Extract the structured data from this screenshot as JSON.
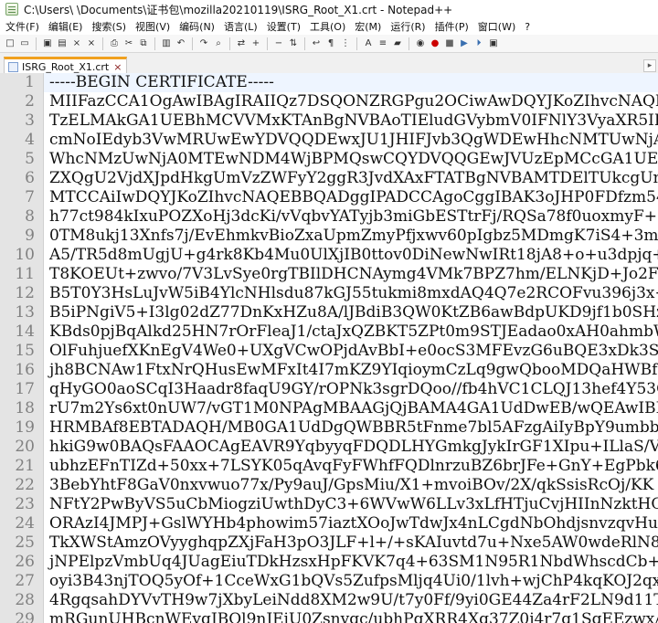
{
  "window": {
    "title": "C:\\Users\\          \\Documents\\证书包\\mozilla20210119\\ISRG_Root_X1.crt - Notepad++"
  },
  "menu": {
    "items": [
      "文件(F)",
      "编辑(E)",
      "搜索(S)",
      "视图(V)",
      "编码(N)",
      "语言(L)",
      "设置(T)",
      "工具(O)",
      "宏(M)",
      "运行(R)",
      "插件(P)",
      "窗口(W)",
      "?"
    ]
  },
  "toolbar": {
    "icons": [
      "new-file-icon",
      "open-file-icon",
      "save-icon",
      "save-all-icon",
      "close-icon",
      "close-all-icon",
      "print-icon",
      "cut-icon",
      "copy-icon",
      "paste-icon",
      "undo-icon",
      "redo-icon",
      "find-icon",
      "replace-icon",
      "zoom-in-icon",
      "zoom-out-icon",
      "sync-scroll-icon",
      "word-wrap-icon",
      "show-all-characters-icon",
      "indent-guide-icon",
      "language-icon",
      "function-list-icon",
      "folder-as-workspace-icon",
      "monitoring-icon",
      "record-macro-icon",
      "stop-recording-icon",
      "playback-macro-icon",
      "run-macro-icon",
      "save-macro-icon"
    ]
  },
  "tabs": [
    {
      "label": "ISRG_Root_X1.crt",
      "close_symbol": "×"
    }
  ],
  "editor": {
    "lines": [
      "-----BEGIN CERTIFICATE-----",
      "MIIFazCCA1OgAwIBAgIRAIIQz7DSQONZRGPgu2OCiwAwDQYJKoZIhvcNAQELBQAw",
      "TzELMAkGA1UEBhMCVVMxKTAnBgNVBAoTIEludGVybmV0IFNlY3VyaXR5IFJlc2Vh",
      "cmNoIEdyb3VwMRUwEwYDVQQDEwxJU1JHIFJvb3QgWDEwHhcNMTUwNjA0MTEwNDM4",
      "WhcNMzUwNjA0MTEwNDM4WjBPMQswCQYDVQQGEwJVUzEpMCcGA1UEChMgSW50ZXJu",
      "ZXQgU2VjdXJpdHkgUmVzZWFyY2ggR3JvdXAxFTATBgNVBAMTDElTUkcgUm9vdCBY",
      "MTCCAiIwDQYJKoZIhvcNAQEBBQADggIPADCCAgoCggIBAK3oJHP0FDfzm54rVygc",
      "h77ct984kIxuPOZXoHj3dcKi/vVqbvYATyjb3miGbESTtrFj/RQSa78f0uoxmyF+",
      "0TM8ukj13Xnfs7j/EvEhmkvBioZxaUpmZmyPfjxwv60pIgbz5MDmgK7iS4+3mX6U",
      "A5/TR5d8mUgjU+g4rk8Kb4Mu0UlXjIB0ttov0DiNewNwIRt18jA8+o+u3dpjq+sW",
      "T8KOEUt+zwvo/7V3LvSye0rgTBIlDHCNAymg4VMk7BPZ7hm/ELNKjD+Jo2FR3qyH",
      "B5T0Y3HsLuJvW5iB4YlcNHlsdu87kGJ55tukmi8mxdAQ4Q7e2RCOFvu396j3x+UC",
      "B5iPNgiV5+I3lg02dZ77DnKxHZu8A/lJBdiB3QW0KtZB6awBdpUKD9jf1b0SHzUv",
      "KBds0pjBqAlkd25HN7rOrFleaJ1/ctaJxQZBKT5ZPt0m9STJEadao0xAH0ahmbWn",
      "OlFuhjuefXKnEgV4We0+UXgVCwOPjdAvBbI+e0ocS3MFEvzG6uBQE3xDk3SzynTn",
      "jh8BCNAw1FtxNrQHusEwMFxIt4I7mKZ9YIqioymCzLq9gwQbooMDQaHWBfEbwrbw",
      "qHyGO0aoSCqI3Haadr8faqU9GY/rOPNk3sgrDQoo//fb4hVC1CLQJ13hef4Y53CI",
      "rU7m2Ys6xt0nUW7/vGT1M0NPAgMBAAGjQjBAMA4GA1UdDwEB/wQEAwIBBjAPBgNV",
      "HRMBAf8EBTADAQH/MB0GA1UdDgQWBBR5tFnme7bl5AFzgAiIyBpY9umbbjANBgkq",
      "hkiG9w0BAQsFAAOCAgEAVR9YqbyyqFDQDLHYGmkgJykIrGF1XIpu+ILlaS/V9lZL",
      "ubhzEFnTIZd+50xx+7LSYK05qAvqFyFWhfFQDlnrzuBZ6brJFe+GnY+EgPbk6ZGQ",
      "3BebYhtF8GaV0nxvwuo77x/Py9auJ/GpsMiu/X1+mvoiBOv/2X/qkSsisRcOj/KK",
      "NFtY2PwByVS5uCbMiogziUwthDyC3+6WVwW6LLv3xLfHTjuCvjHIInNzktHCgKQ5",
      "ORAzI4JMPJ+GslWYHb4phowim57iaztXOoJwTdwJx4nLCgdNbOhdjsnvzqvHu7Ur",
      "TkXWStAmzOVyyghqpZXjFaH3pO3JLF+l+/+sKAIuvtd7u+Nxe5AW0wdeRlN8NwdC",
      "jNPElpzVmbUq4JUagEiuTDkHzsxHpFKVK7q4+63SM1N95R1NbdWhscdCb+ZAJzVc",
      "oyi3B43njTOQ5yOf+1CceWxG1bQVs5ZufpsMljq4Ui0/1lvh+wjChP4kqKOJ2qxq",
      "4RgqsahDYVvTH9w7jXbyLeiNdd8XM2w9U/t7y0Ff/9yi0GE44Za4rF2LN9d11TPA",
      "mRGunUHBcnWEvgJBQl9nJEiU0Zsnvgc/ubhPgXRR4Xq37Z0j4r7g1SgEEzwxA57d"
    ]
  }
}
